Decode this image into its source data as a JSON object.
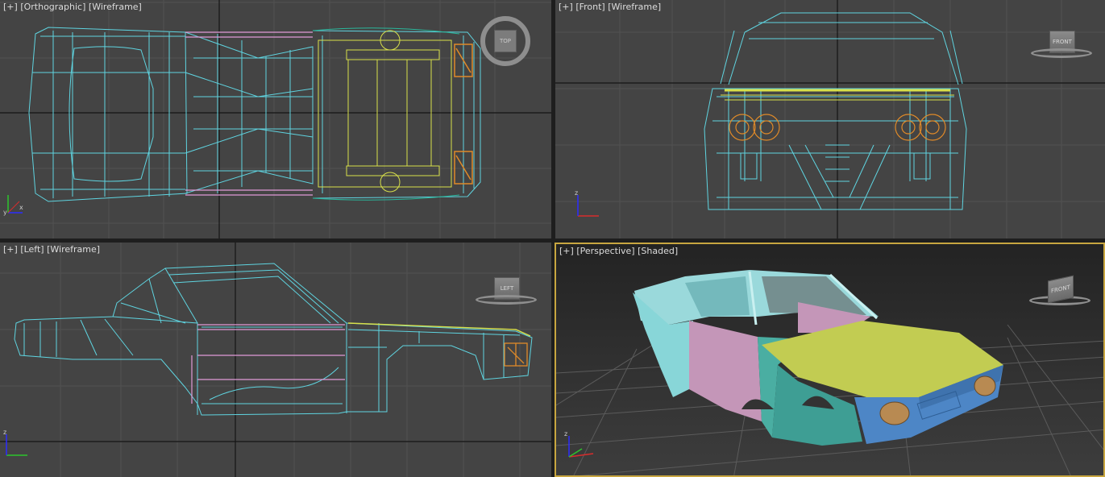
{
  "viewports": {
    "top_left": {
      "plus": "[+]",
      "view": "[Orthographic]",
      "mode": "[Wireframe]",
      "cube_label": "TOP"
    },
    "top_right": {
      "plus": "[+]",
      "view": "[Front]",
      "mode": "[Wireframe]",
      "cube_label": "FRONT"
    },
    "bottom_left": {
      "plus": "[+]",
      "view": "[Left]",
      "mode": "[Wireframe]",
      "cube_label": "LEFT"
    },
    "bottom_right": {
      "plus": "[+]",
      "view": "[Perspective]",
      "mode": "[Shaded]",
      "cube_label": "FRONT"
    }
  },
  "axis_labels": {
    "x": "x",
    "y": "y",
    "z": "z"
  },
  "colors": {
    "viewport_bg": "#444444",
    "active_border": "#c8a640",
    "wire_cyan": "#5fd4e0",
    "wire_pink": "#e19ad8",
    "wire_yellow": "#d8e04a",
    "wire_orange": "#e08a28",
    "shade_cyan": "#88d6d8",
    "shade_pink": "#c496b8",
    "shade_green": "#4aaea2",
    "shade_yellow": "#c2cc52",
    "shade_blue": "#4d86c6"
  }
}
